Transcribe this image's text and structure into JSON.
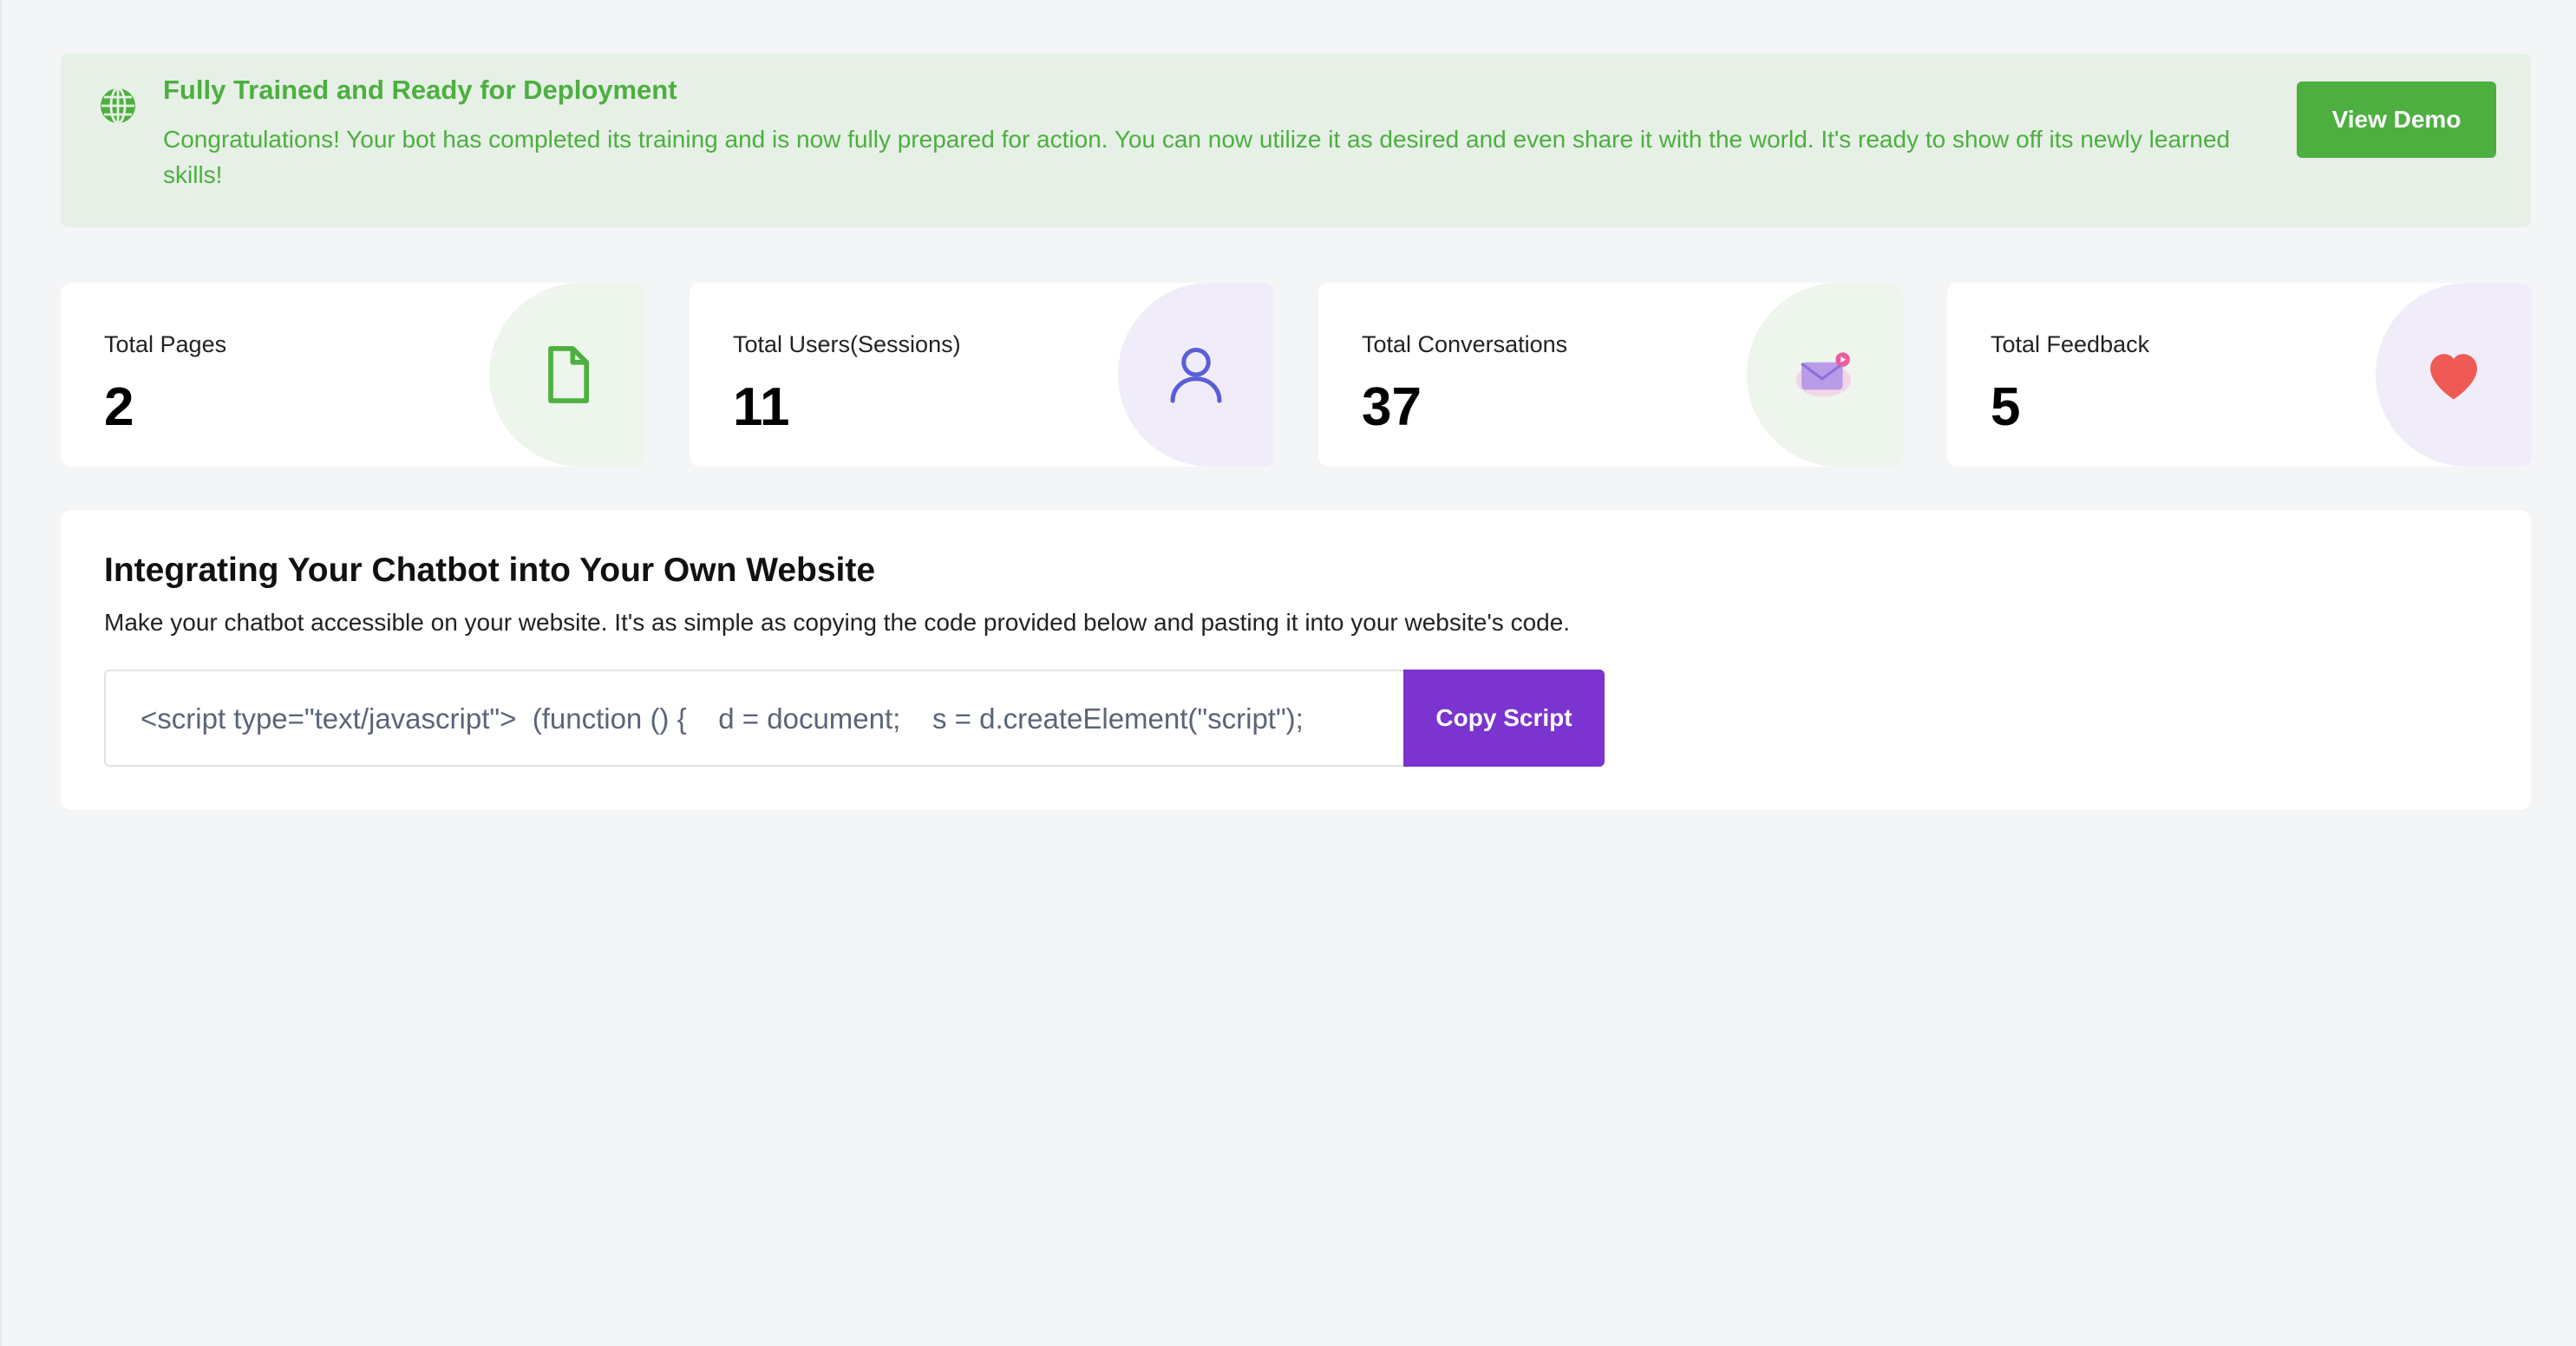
{
  "banner": {
    "icon": "globe-icon",
    "title": "Fully Trained and Ready for Deployment",
    "text": "Congratulations! Your bot has completed its training and is now fully prepared for action. You can now utilize it as desired and even share it with the world. It's ready to show off its newly learned skills!",
    "button_label": "View Demo",
    "color": "#4caf3f"
  },
  "stats": [
    {
      "label": "Total Pages",
      "value": "2",
      "icon": "document-icon"
    },
    {
      "label": "Total Users(Sessions)",
      "value": "11",
      "icon": "user-icon"
    },
    {
      "label": "Total Conversations",
      "value": "37",
      "icon": "envelope-icon"
    },
    {
      "label": "Total Feedback",
      "value": "5",
      "icon": "heart-icon"
    }
  ],
  "integration": {
    "title": "Integrating Your Chatbot into Your Own Website",
    "description": "Make your chatbot accessible on your website. It's as simple as copying the code provided below and pasting it into your website's code.",
    "script_preview": "<script type=\"text/javascript\">  (function () {    d = document;    s = d.createElement(\"script\");",
    "copy_label": "Copy Script",
    "accent": "#7b34cf"
  }
}
